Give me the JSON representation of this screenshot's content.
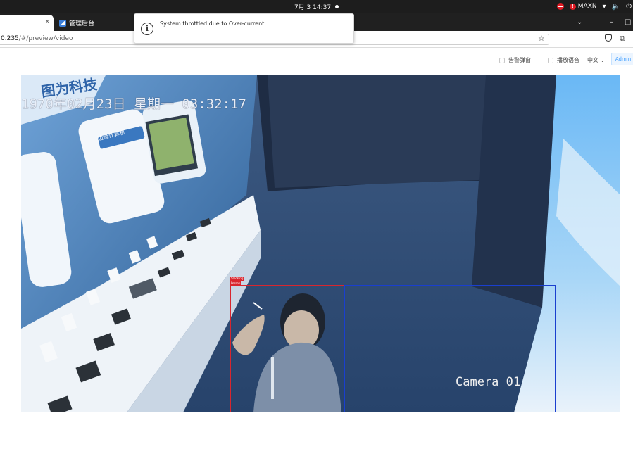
{
  "os_bar": {
    "datetime": "7月 3  14:37",
    "power_mode": "MAXN"
  },
  "browser": {
    "active_tab": {
      "title": "",
      "close_glyph": "×"
    },
    "inactive_tab": {
      "title": "管理后台"
    },
    "url": {
      "host": "0.235",
      "path": "/#/preview/video"
    }
  },
  "notification": {
    "message": "System throttled due to Over-current.",
    "icon": "info-icon"
  },
  "toolbar": {
    "alarm_popup_label": "告警弹窗",
    "alarm_popup_checked": false,
    "voice_broadcast_label": "播放语音",
    "voice_broadcast_checked": false,
    "language": "中文",
    "user_button": "Admin"
  },
  "video": {
    "osd_datetime": "1970年02月23日  星期一  03:32:17",
    "camera_name": "Camera 01",
    "wall_logo": "图为科技",
    "panel_title": "边缘计算机",
    "detections": [
      {
        "label": "Smoking",
        "color": "#d9262e"
      },
      {
        "label": "Person",
        "color": "#1a3fcf"
      }
    ]
  }
}
